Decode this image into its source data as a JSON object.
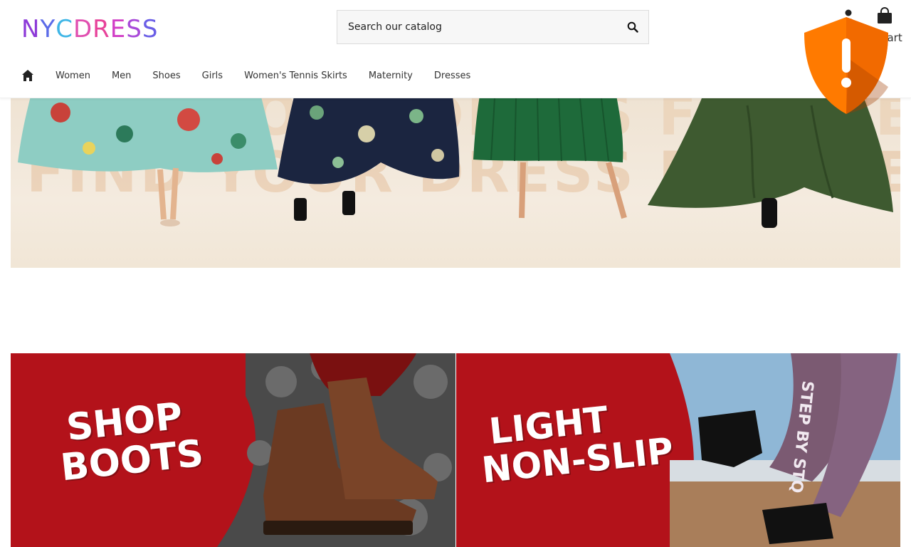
{
  "brand": {
    "logo_text": "NYCDRESS",
    "letters": [
      "N",
      "Y",
      "C",
      "D",
      "R",
      "E",
      "S",
      "S"
    ]
  },
  "search": {
    "placeholder": "Search our catalog"
  },
  "header": {
    "cart_label": "Cart"
  },
  "nav": {
    "items": [
      {
        "label": "Women"
      },
      {
        "label": "Men"
      },
      {
        "label": "Shoes"
      },
      {
        "label": "Girls"
      },
      {
        "label": "Women's Tennis Skirts"
      },
      {
        "label": "Maternity"
      },
      {
        "label": "Dresses"
      }
    ]
  },
  "hero": {
    "watermark_text": "FIND YOUR DRESS FOR ME!"
  },
  "promos": [
    {
      "line1": "SHOP",
      "line2": "BOOTS"
    },
    {
      "line1": "LIGHT",
      "line2": "NON-SLIP",
      "leg_text": "STEP BY STQ"
    }
  ],
  "colors": {
    "promo_red": "#b3121a",
    "shield_orange": "#ff7a00",
    "text_dark": "#333333"
  },
  "icons": {
    "home": "home-icon",
    "search": "search-icon",
    "user": "user-icon",
    "cart": "shopping-bag-icon",
    "alert": "shield-alert-icon"
  }
}
